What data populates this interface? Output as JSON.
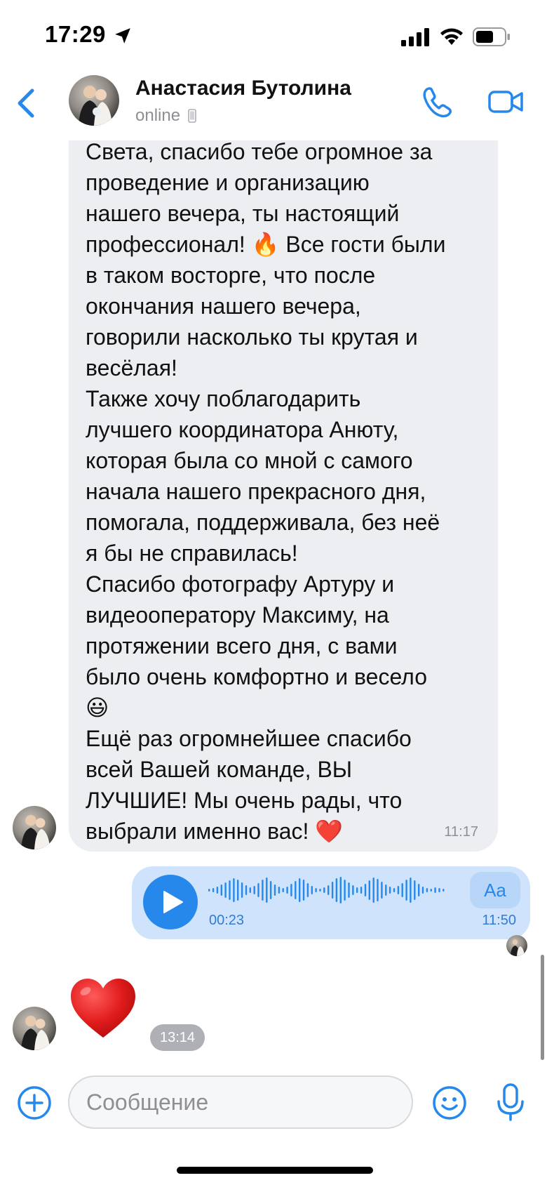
{
  "status_bar": {
    "time": "17:29"
  },
  "header": {
    "contact_name": "Анастасия Бутолина",
    "status": "online"
  },
  "messages": [
    {
      "direction": "incoming",
      "text": "Света, спасибо тебе огромное за\nпроведение и организацию\nнашего вечера, ты настоящий\nпрофессионал! 🔥 Все гости были\nв таком восторге, что после\nокончания нашего вечера,\nговорили насколько ты крутая и\nвесёлая!\nТакже хочу поблагодарить\nлучшего координатора Анюту,\nкоторая была со мной с самого\nначала нашего прекрасного дня,\nпомогала, поддерживала, без неё\nя бы не справилась!\nСпасибо фотографу Артуру и\nвидеооператору Максиму, на\nпротяжении всего дня, с вами\nбыло очень комфортно и весело\n😃\nЕщё раз огромнейшее спасибо\nвсей Вашей команде, ВЫ\nЛУЧШИЕ! Мы очень рады, что\nвыбрали именно вас! ❤️",
      "time": "11:17"
    },
    {
      "direction": "outgoing",
      "type": "voice",
      "duration": "00:23",
      "transcribe_label": "Aa",
      "time": "11:50"
    },
    {
      "direction": "incoming",
      "type": "emoji",
      "emoji": "heart",
      "time": "13:14"
    }
  ],
  "composer": {
    "placeholder": "Сообщение"
  },
  "colors": {
    "accent": "#2688eb",
    "incoming_bubble": "#edeef2",
    "outgoing_bubble": "#cfe4fc"
  }
}
